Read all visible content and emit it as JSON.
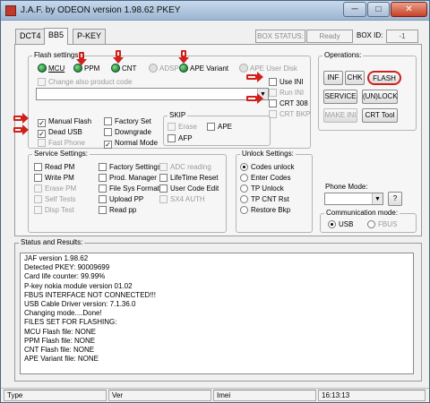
{
  "window": {
    "title": "J.A.F. by ODEON version 1.98.62 PKEY",
    "min_glyph": "─",
    "max_glyph": "□",
    "close_glyph": "✕"
  },
  "tabs": [
    {
      "label": "DCT4",
      "active": false
    },
    {
      "label": "BB5",
      "active": true
    },
    {
      "label": "P-KEY",
      "active": false
    }
  ],
  "box_status": {
    "label": "BOX STATUS:",
    "value": "Ready",
    "id_label": "BOX ID:",
    "id_value": "-1"
  },
  "flash_settings": {
    "legend": "Flash settings",
    "leds": [
      {
        "label": "MCU",
        "on": true
      },
      {
        "label": "PPM",
        "on": true
      },
      {
        "label": "CNT",
        "on": true
      },
      {
        "label": "ADSP",
        "on": false
      },
      {
        "label": "APE Variant",
        "on": true
      },
      {
        "label": "APE User Disk",
        "on": false
      }
    ],
    "change_product_code": "Change also product code",
    "use_ini": "Use INI",
    "run_ini": "Run INI",
    "crt_308": "CRT 308",
    "crt_bkp": "CRT BKP",
    "manual_flash": "Manual Flash",
    "dead_usb": "Dead USB",
    "fast_phone": "Fast Phone",
    "factory_set": "Factory Set",
    "downgrade": "Downgrade",
    "normal_mode": "Normal Mode",
    "skip": {
      "legend": "SKIP",
      "erase": "Erase",
      "ape": "APE",
      "afp": "AFP"
    }
  },
  "service_settings": {
    "legend": "Service Settings:",
    "items": [
      "Read PM",
      "Write PM",
      "Erase PM",
      "Self Tests",
      "Disp Test",
      "Factory Settings",
      "Prod. Manager",
      "File Sys Format",
      "Upload PP",
      "Read pp",
      "ADC reading",
      "LifeTime Reset",
      "User Code Edit",
      "SX4 AUTH"
    ]
  },
  "unlock_settings": {
    "legend": "Unlock Settings:",
    "options": [
      "Codes unlock",
      "Enter Codes",
      "TP Unlock",
      "TP CNT Rst",
      "Restore Bkp"
    ]
  },
  "operations": {
    "legend": "Operations:",
    "buttons": [
      "INF",
      "CHK",
      "FLASH",
      "SERVICE",
      "(UN)LOCK",
      "MAKE INI",
      "CRT Tool"
    ]
  },
  "phone_mode": {
    "label": "Phone Mode:",
    "help": "?"
  },
  "comm_mode": {
    "legend": "Communication mode:",
    "usb": "USB",
    "fbus": "FBUS"
  },
  "results": {
    "legend": "Status and Results:",
    "lines": [
      "JAF version 1.98.62",
      "Detected PKEY: 90009699",
      "Card life counter: 99.99%",
      "P-key nokia module version 01.02",
      "FBUS INTERFACE NOT CONNECTED!!!",
      "USB Cable Driver version: 7.1.36.0",
      "Changing mode....Done!",
      "FILES SET FOR FLASHING:",
      "MCU Flash file: NONE",
      "PPM Flash file: NONE",
      "CNT Flash file: NONE",
      "APE Variant file: NONE"
    ]
  },
  "statusbar": {
    "type": "Type",
    "ver": "Ver",
    "imei": "Imei",
    "time": "16:13:13"
  },
  "colors": {
    "accent_red": "#d0201a",
    "led_green": "#1a9a1a",
    "title_blue": "#9cb5d1"
  }
}
